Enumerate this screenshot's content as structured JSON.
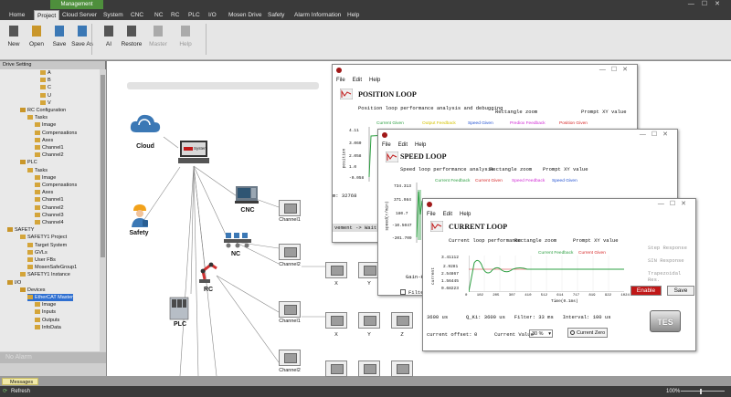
{
  "app": {
    "context_tab": "Management"
  },
  "menu": {
    "tabs": [
      "Home",
      "Project",
      "Cloud Server",
      "System",
      "CNC",
      "NC",
      "RC",
      "PLC",
      "I/O",
      "Mosen Drive",
      "Safety",
      "Alarm Information",
      "Help"
    ],
    "active": "Project"
  },
  "ribbon": {
    "buttons": [
      {
        "label": "New",
        "icon": "new-file-icon",
        "enabled": true
      },
      {
        "label": "Open",
        "icon": "folder-open-icon",
        "enabled": true
      },
      {
        "label": "Save",
        "icon": "save-icon",
        "enabled": true
      },
      {
        "label": "Save As",
        "icon": "save-as-icon",
        "enabled": true
      },
      {
        "label": "AI",
        "icon": "ai-icon",
        "enabled": true
      },
      {
        "label": "Restore",
        "icon": "restore-icon",
        "enabled": true
      },
      {
        "label": "Master",
        "icon": "master-icon",
        "enabled": false
      },
      {
        "label": "Help",
        "icon": "help-icon",
        "enabled": false
      }
    ]
  },
  "tree": {
    "header": "Drive Setting",
    "items": [
      {
        "text": "A",
        "selected": false
      },
      {
        "text": "B",
        "selected": false
      },
      {
        "text": "C",
        "selected": false
      },
      {
        "text": "U",
        "selected": false
      },
      {
        "text": "V",
        "selected": false
      },
      {
        "text": "RC Configuration",
        "selected": false
      },
      {
        "text": "Tasks",
        "selected": false
      },
      {
        "text": "Image",
        "selected": false
      },
      {
        "text": "Compensations",
        "selected": false
      },
      {
        "text": "Axes",
        "selected": false
      },
      {
        "text": "Channel1",
        "selected": false
      },
      {
        "text": "Channel2",
        "selected": false
      },
      {
        "text": "PLC",
        "selected": false
      },
      {
        "text": "Tasks",
        "selected": false
      },
      {
        "text": "Image",
        "selected": false
      },
      {
        "text": "Compensations",
        "selected": false
      },
      {
        "text": "Axes",
        "selected": false
      },
      {
        "text": "Channel1",
        "selected": false
      },
      {
        "text": "Channel2",
        "selected": false
      },
      {
        "text": "Channel3",
        "selected": false
      },
      {
        "text": "Channel4",
        "selected": false
      },
      {
        "text": "SAFETY",
        "selected": false
      },
      {
        "text": "SAFETY1 Project",
        "selected": false
      },
      {
        "text": "Target System",
        "selected": false
      },
      {
        "text": "GVLs",
        "selected": false
      },
      {
        "text": "User FBs",
        "selected": false
      },
      {
        "text": "MosenSafeGroup1",
        "selected": false
      },
      {
        "text": "SAFETY1 Instance",
        "selected": false
      },
      {
        "text": "I/O",
        "selected": false
      },
      {
        "text": "Devices",
        "selected": false
      },
      {
        "text": "EtherCAT Master",
        "selected": true
      },
      {
        "text": "Image",
        "selected": false
      },
      {
        "text": "Inputs",
        "selected": false
      },
      {
        "text": "Outputs",
        "selected": false
      },
      {
        "text": "InfoData",
        "selected": false
      }
    ]
  },
  "alarm_pane": {
    "text": "No Alarm"
  },
  "messages_tab": "Messages",
  "statusbar": {
    "left": "Refresh",
    "zoom": "100%"
  },
  "diagram": {
    "nodes": {
      "cloud": "Cloud",
      "safety": "Safety",
      "cnc": "CNC",
      "nc": "NC",
      "rc": "RC",
      "plc": "PLC",
      "system_badge": "System"
    },
    "channels": [
      "Channel1",
      "Channel2",
      "Channel1",
      "Channel2",
      "Channel1",
      "Channel2"
    ],
    "axes": [
      "X",
      "Y",
      "X",
      "Y",
      "Z"
    ]
  },
  "position_loop": {
    "menu": [
      "File",
      "Edit",
      "Help"
    ],
    "title": "POSITION LOOP",
    "desc": "Position loop performance analysis and debugging",
    "mode": "Rectangle zoom",
    "mode2": "Prompt XY value",
    "legend": [
      "Current Given",
      "Output Feedback",
      "Speed Given",
      "Prediox Feedback",
      "Position Given"
    ],
    "ylabel": "position",
    "yticks": [
      "4.11",
      "3.060",
      "2.058",
      "1.0",
      "-0.058"
    ],
    "status": "m: 32768",
    "status2": "vement -> Wait t"
  },
  "speed_loop": {
    "menu": [
      "File",
      "Edit",
      "Help"
    ],
    "title": "SPEED LOOP",
    "desc": "Speed loop performance analysis",
    "mode": "Rectangle zoom",
    "mode2": "Prompt XY value",
    "legend": [
      "Current Feedback",
      "Current Given",
      "Speed Feedback",
      "Speed Given"
    ],
    "ylabel": "speed(r/min)",
    "yticks": [
      "734.313",
      "371.984",
      "180.7",
      "-10.5047",
      "-201.709"
    ],
    "gain": "Gain-Kp",
    "filter": "Filte"
  },
  "current_loop": {
    "menu": [
      "File",
      "Edit",
      "Help"
    ],
    "title": "CURRENT LOOP",
    "desc": "Current loop performance",
    "mode": "Rectangle zoom",
    "mode2": "Prompt XY value",
    "legend": [
      "Current Feedback",
      "Current Given"
    ],
    "ylabel": "current",
    "yticks": [
      "3.41112",
      "2.9281",
      "2.54867",
      "1.56445",
      "0.68223"
    ],
    "xticks": [
      "0",
      "102",
      "205",
      "307",
      "410",
      "512",
      "614",
      "717",
      "819",
      "922",
      "1024"
    ],
    "xlabel": "Time(0.1ms)",
    "responses": [
      "Step Response",
      "SIN Response",
      "Trapezoidal Res."
    ],
    "enable": "Enable",
    "save": "Save",
    "params": {
      "a": "3600",
      "a_unit": "us",
      "b_label": "Q_Ki:",
      "b": "3600",
      "b_unit": "us",
      "filter_label": "Filter:",
      "filter": "33",
      "filter_unit": "ms",
      "interval_label": "Interval:",
      "interval": "100",
      "interval_unit": "us"
    },
    "offset_label": "current offset:",
    "offset": "0",
    "cur_value_label": "Current Value",
    "cur_value": "30 %",
    "zero_label": "Current Zero",
    "test_label": "TES"
  },
  "colors": {
    "accent_green": "#4e8f3c",
    "selected_blue": "#2e6fd1",
    "title_dark": "#3a3a3a",
    "feedback_green": "#2ea043",
    "given_red": "#d62728"
  }
}
